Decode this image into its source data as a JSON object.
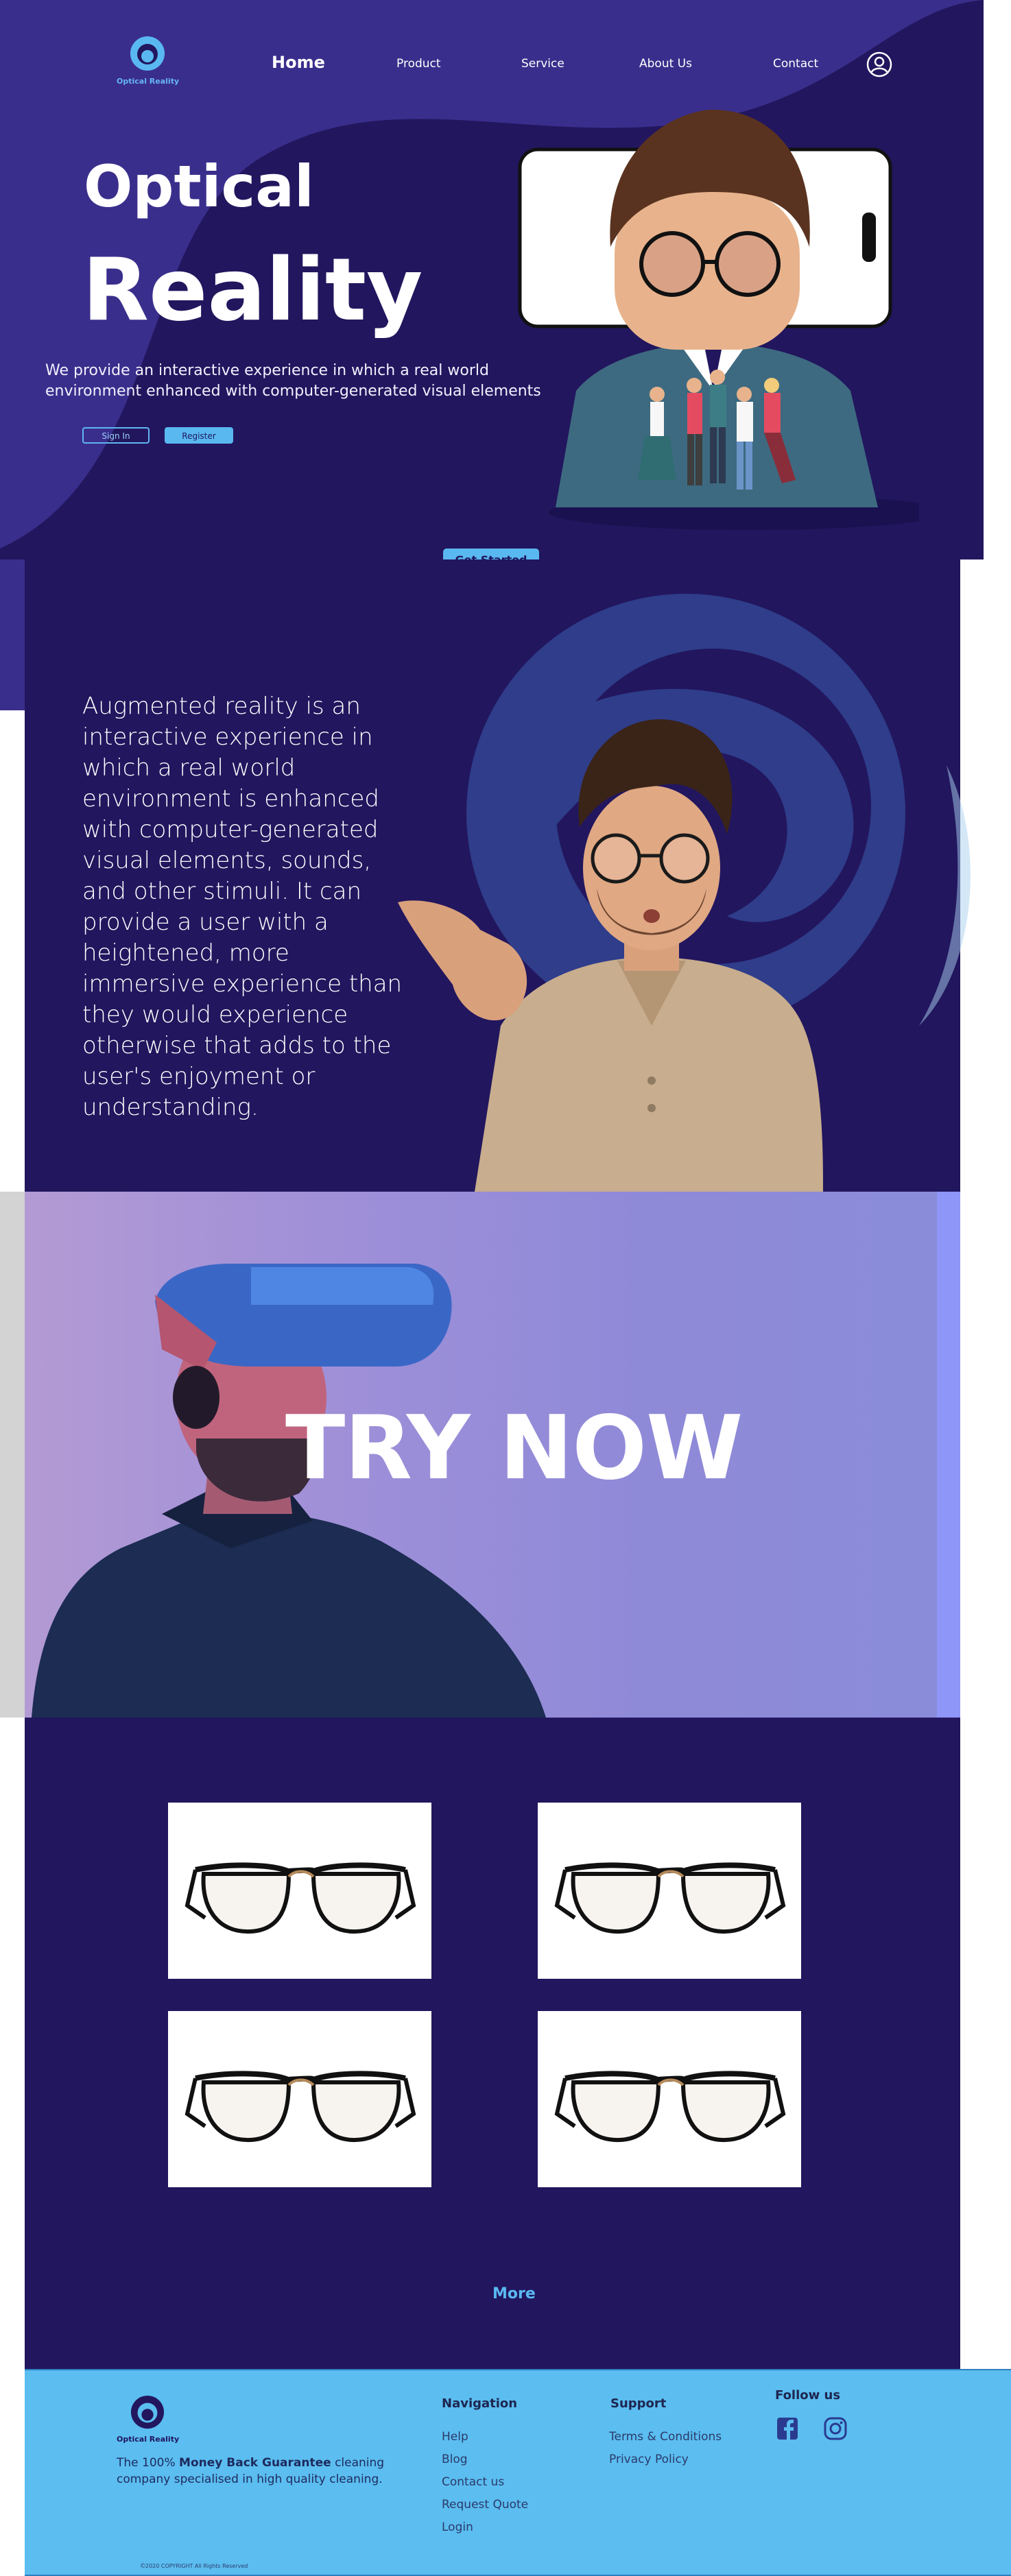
{
  "colors": {
    "hero_bg_dark": "#22165e",
    "hero_wave_light": "#3a2e8c",
    "accent_blue": "#5ab8f0",
    "footer_bg": "#5bbdf0",
    "try_now_gradient_start": "#b39ad4",
    "try_now_gradient_end": "#8a8cd9"
  },
  "logo": {
    "text": "Optical Reality",
    "icon": "eye-ring-icon"
  },
  "nav": {
    "home": "Home",
    "product": "Product",
    "service": "Service",
    "about": "About Us",
    "contact": "Contact",
    "user_icon": "user-circle-icon"
  },
  "hero": {
    "title_line_1": "Optical",
    "title_line_2": "Reality",
    "description": "We provide an interactive experience in which a real world environment enhanced with computer-generated visual elements",
    "signin_label": "Sign In",
    "register_label": "Register",
    "get_started_label": "Get Started"
  },
  "about": {
    "text": "Augmented reality is an interactive experience in which a real world environment is enhanced with computer-generated visual elements, sounds, and other stimuli. It can provide a user with a heightened, more immersive experience than they would experience otherwise that adds to the user's enjoyment or understanding."
  },
  "try_now": {
    "label": "TRY NOW"
  },
  "products": {
    "items": [
      {
        "image": "glasses-image"
      },
      {
        "image": "glasses-image"
      },
      {
        "image": "glasses-image"
      },
      {
        "image": "glasses-image"
      }
    ],
    "more_label": "More"
  },
  "footer": {
    "logo_text": "Optical Reality",
    "desc_prefix": "The 100% ",
    "desc_bold": "Money Back Guarantee",
    "desc_suffix": " cleaning company specialised in high quality cleaning.",
    "navigation_heading": "Navigation",
    "navigation_items": [
      "Help",
      "Blog",
      "Contact us",
      "Request Quote",
      "Login"
    ],
    "support_heading": "Support",
    "support_items": [
      "Terms & Conditions",
      "Privacy Policy"
    ],
    "follow_heading": "Follow us",
    "social_icons": [
      "facebook-icon",
      "instagram-icon"
    ],
    "copyright_symbol": "©",
    "copyright": "2020 COPYRIGHT      All Rights Reserved"
  }
}
